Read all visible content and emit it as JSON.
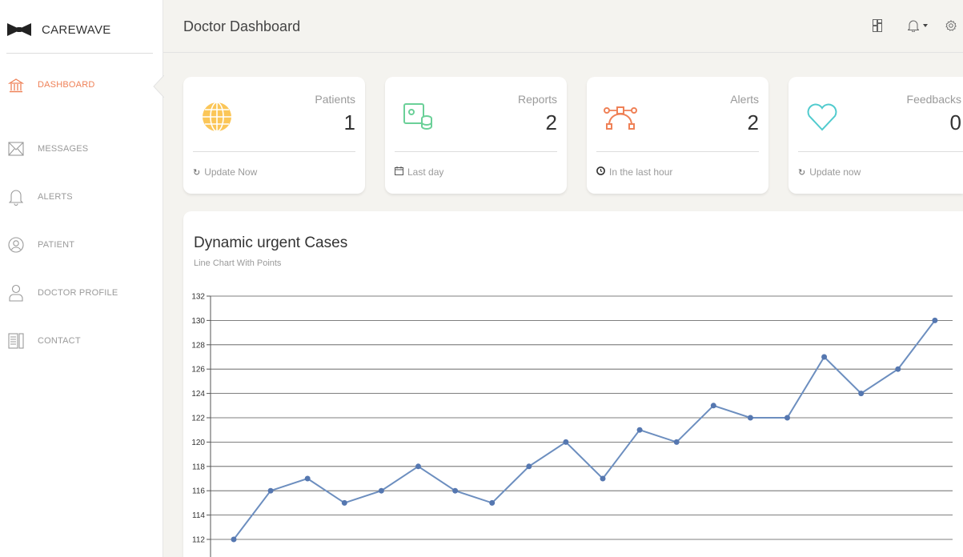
{
  "app": {
    "brand": "CAREWAVE"
  },
  "sidebar": {
    "items": [
      {
        "label": "DASHBOARD",
        "icon": "bank-icon",
        "active": true
      },
      {
        "label": "MESSAGES",
        "icon": "envelope-icon",
        "active": false
      },
      {
        "label": "ALERTS",
        "icon": "bell-icon",
        "active": false
      },
      {
        "label": "PATIENT",
        "icon": "user-circle-icon",
        "active": false
      },
      {
        "label": "DOCTOR PROFILE",
        "icon": "person-icon",
        "active": false
      },
      {
        "label": "CONTACT",
        "icon": "paper-icon",
        "active": false
      }
    ]
  },
  "header": {
    "title": "Doctor Dashboard"
  },
  "cards": [
    {
      "title": "Patients",
      "value": "1",
      "footer": "Update Now",
      "icon": "globe-icon",
      "footer_icon": "refresh-icon",
      "color": "#fbc658"
    },
    {
      "title": "Reports",
      "value": "2",
      "footer": "Last day",
      "icon": "money-coins-icon",
      "footer_icon": "calendar-icon",
      "color": "#6bd098"
    },
    {
      "title": "Alerts",
      "value": "2",
      "footer": "In the last hour",
      "icon": "vector-icon",
      "footer_icon": "clock-icon",
      "color": "#ef8157"
    },
    {
      "title": "Feedbacks",
      "value": "0",
      "footer": "Update now",
      "icon": "heart-icon",
      "footer_icon": "refresh-icon",
      "color": "#51cbce"
    }
  ],
  "chart": {
    "title": "Dynamic urgent Cases",
    "subtitle": "Line Chart With Points"
  },
  "chart_data": {
    "type": "line",
    "series": [
      {
        "values": [
          112,
          116,
          117,
          115,
          116,
          118,
          116,
          115,
          118,
          120,
          117,
          121,
          120,
          123,
          122,
          122,
          127,
          124,
          126,
          130
        ]
      }
    ],
    "y_ticks": [
      112,
      114,
      116,
      118,
      120,
      122,
      124,
      126,
      128,
      130,
      132
    ],
    "ylim": [
      112,
      132
    ],
    "grid": true,
    "color": "#6c8ebf"
  }
}
